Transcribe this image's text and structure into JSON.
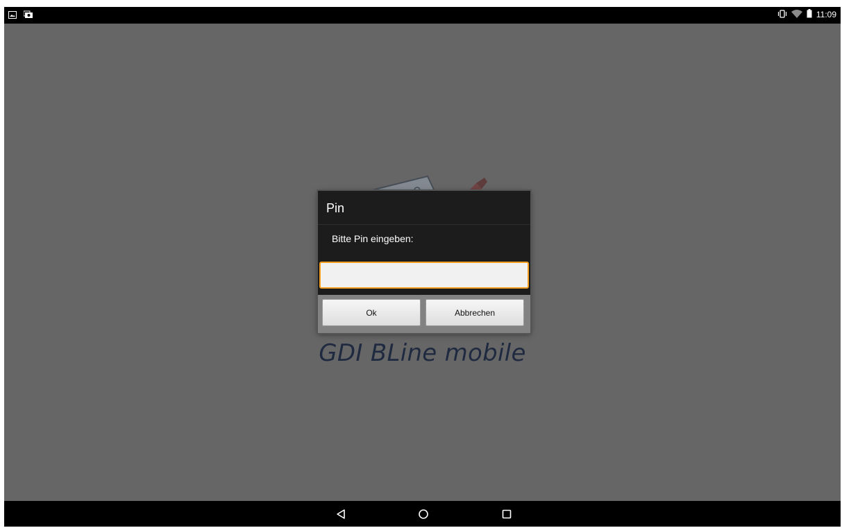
{
  "status_bar": {
    "left_icons": [
      "image-notification-icon",
      "screenshot-notification-icon"
    ],
    "right_icons": [
      "vibrate-icon",
      "wifi-icon",
      "battery-icon"
    ],
    "time": "11:09"
  },
  "app": {
    "title": "GDI BLine mobile"
  },
  "dialog": {
    "title": "Pin",
    "message": "Bitte Pin eingeben:",
    "input_value": "",
    "input_placeholder": "",
    "ok_label": "Ok",
    "cancel_label": "Abbrechen",
    "focus_color": "#f5a023"
  },
  "nav_bar": {
    "buttons": [
      "back-icon",
      "home-icon",
      "recents-icon"
    ]
  },
  "colors": {
    "background_dim": "#666666",
    "title_text": "#1f2a40",
    "dialog_bg": "#1c1c1c"
  }
}
